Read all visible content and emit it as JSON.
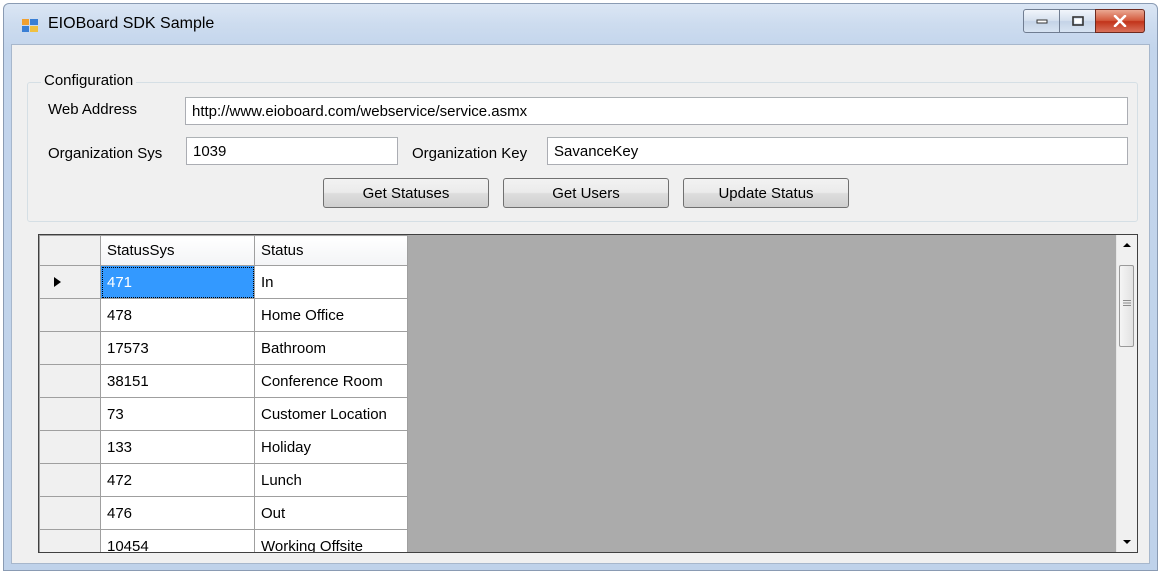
{
  "window": {
    "title": "EIOBoard SDK Sample"
  },
  "config": {
    "group_label": "Configuration",
    "web_address_label": "Web Address",
    "web_address_value": "http://www.eioboard.com/webservice/service.asmx",
    "org_sys_label": "Organization Sys",
    "org_sys_value": "1039",
    "org_key_label": "Organization Key",
    "org_key_value": "SavanceKey"
  },
  "buttons": {
    "get_statuses": "Get Statuses",
    "get_users": "Get Users",
    "update_status": "Update Status"
  },
  "grid": {
    "columns": [
      "StatusSys",
      "Status"
    ],
    "rows": [
      [
        "471",
        "In"
      ],
      [
        "478",
        "Home Office"
      ],
      [
        "17573",
        "Bathroom"
      ],
      [
        "38151",
        "Conference Room"
      ],
      [
        "73",
        "Customer Location"
      ],
      [
        "133",
        "Holiday"
      ],
      [
        "472",
        "Lunch"
      ],
      [
        "476",
        "Out"
      ],
      [
        "10454",
        "Working Offsite"
      ]
    ],
    "selected_row": 0
  },
  "icons": {
    "app": "app-grid-icon",
    "minimize": "minimize-icon",
    "maximize": "maximize-icon",
    "close": "close-icon",
    "row_indicator": "current-row-arrow-icon"
  },
  "colors": {
    "selection": "#3399ff",
    "close_button": "#c2331a"
  }
}
